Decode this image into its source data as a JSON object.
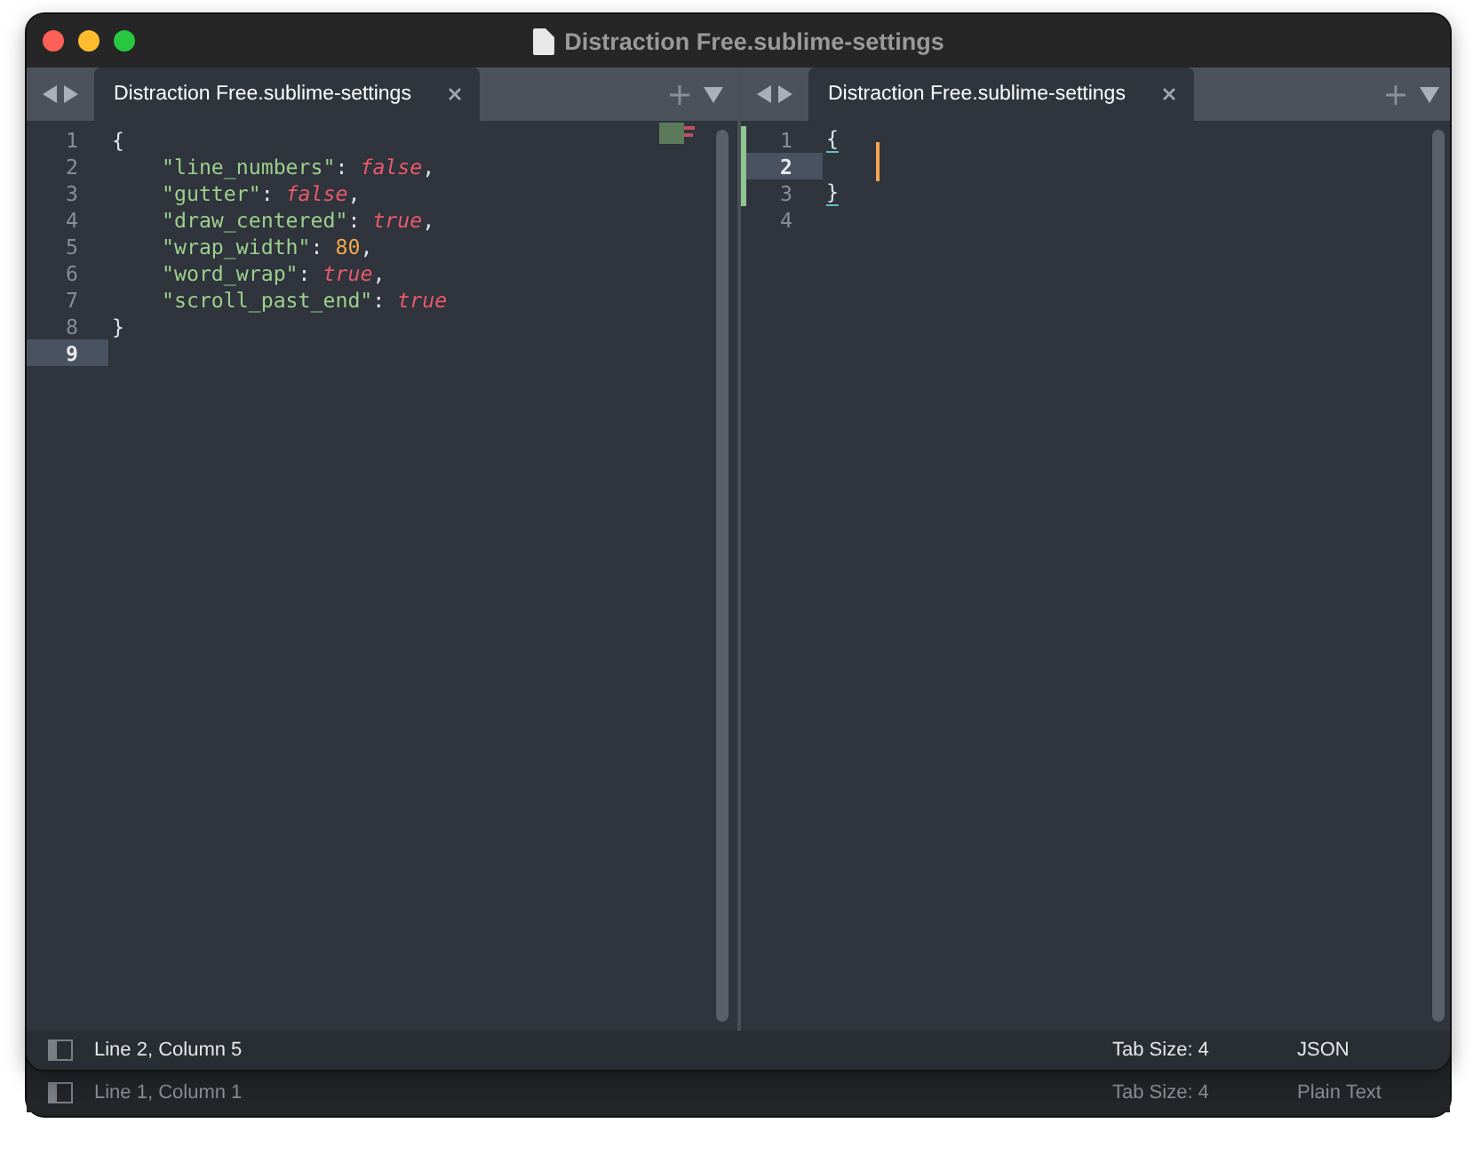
{
  "window": {
    "title": "Distraction Free.sublime-settings"
  },
  "panes": [
    {
      "tab": {
        "label": "Distraction Free.sublime-settings",
        "selected": true
      },
      "lines": [
        {
          "number": "1",
          "current": false,
          "modified": false,
          "indented": false,
          "tokens": [
            {
              "kind": "punct",
              "text": "{",
              "matched": false
            }
          ]
        },
        {
          "number": "2",
          "current": false,
          "modified": false,
          "indented": true,
          "tokens": [
            {
              "kind": "key",
              "text": "\"line_numbers\""
            },
            {
              "kind": "punct",
              "text": ":"
            },
            {
              "kind": "bool",
              "text": "false"
            },
            {
              "kind": "punct",
              "text": ","
            }
          ]
        },
        {
          "number": "3",
          "current": false,
          "modified": false,
          "indented": true,
          "tokens": [
            {
              "kind": "key",
              "text": "\"gutter\""
            },
            {
              "kind": "punct",
              "text": ":"
            },
            {
              "kind": "bool",
              "text": "false"
            },
            {
              "kind": "punct",
              "text": ","
            }
          ]
        },
        {
          "number": "4",
          "current": false,
          "modified": false,
          "indented": true,
          "tokens": [
            {
              "kind": "key",
              "text": "\"draw_centered\""
            },
            {
              "kind": "punct",
              "text": ":"
            },
            {
              "kind": "bool",
              "text": "true"
            },
            {
              "kind": "punct",
              "text": ","
            }
          ]
        },
        {
          "number": "5",
          "current": false,
          "modified": false,
          "indented": true,
          "tokens": [
            {
              "kind": "key",
              "text": "\"wrap_width\""
            },
            {
              "kind": "punct",
              "text": ":"
            },
            {
              "kind": "number",
              "text": "80"
            },
            {
              "kind": "punct",
              "text": ","
            }
          ]
        },
        {
          "number": "6",
          "current": false,
          "modified": false,
          "indented": true,
          "tokens": [
            {
              "kind": "key",
              "text": "\"word_wrap\""
            },
            {
              "kind": "punct",
              "text": ":"
            },
            {
              "kind": "bool",
              "text": "true"
            },
            {
              "kind": "punct",
              "text": ","
            }
          ]
        },
        {
          "number": "7",
          "current": false,
          "modified": false,
          "indented": true,
          "tokens": [
            {
              "kind": "key",
              "text": "\"scroll_past_end\""
            },
            {
              "kind": "punct",
              "text": ":"
            },
            {
              "kind": "bool",
              "text": "true"
            }
          ]
        },
        {
          "number": "8",
          "current": false,
          "modified": false,
          "indented": false,
          "tokens": [
            {
              "kind": "punct",
              "text": "}",
              "matched": false
            }
          ]
        },
        {
          "number": "9",
          "current": true,
          "modified": false
        }
      ]
    },
    {
      "tab": {
        "label": "Distraction Free.sublime-settings",
        "selected": true
      },
      "lines": [
        {
          "number": "1",
          "current": false,
          "modified": true,
          "indented": false,
          "tokens": [
            {
              "kind": "punct",
              "text": "{",
              "matched": true
            }
          ]
        },
        {
          "number": "2",
          "current": true,
          "modified": true,
          "indented": true,
          "caret": true
        },
        {
          "number": "3",
          "current": false,
          "modified": true,
          "indented": false,
          "tokens": [
            {
              "kind": "punct",
              "text": "}",
              "matched": true
            }
          ]
        },
        {
          "number": "4",
          "current": false,
          "modified": false
        }
      ]
    }
  ],
  "status_bar": {
    "position": "Line 2, Column 5",
    "tab_size": "Tab Size: 4",
    "syntax": "JSON"
  },
  "back_window": {
    "status_bar": {
      "position": "Line 1, Column 1",
      "tab_size": "Tab Size: 4",
      "syntax": "Plain Text"
    }
  }
}
